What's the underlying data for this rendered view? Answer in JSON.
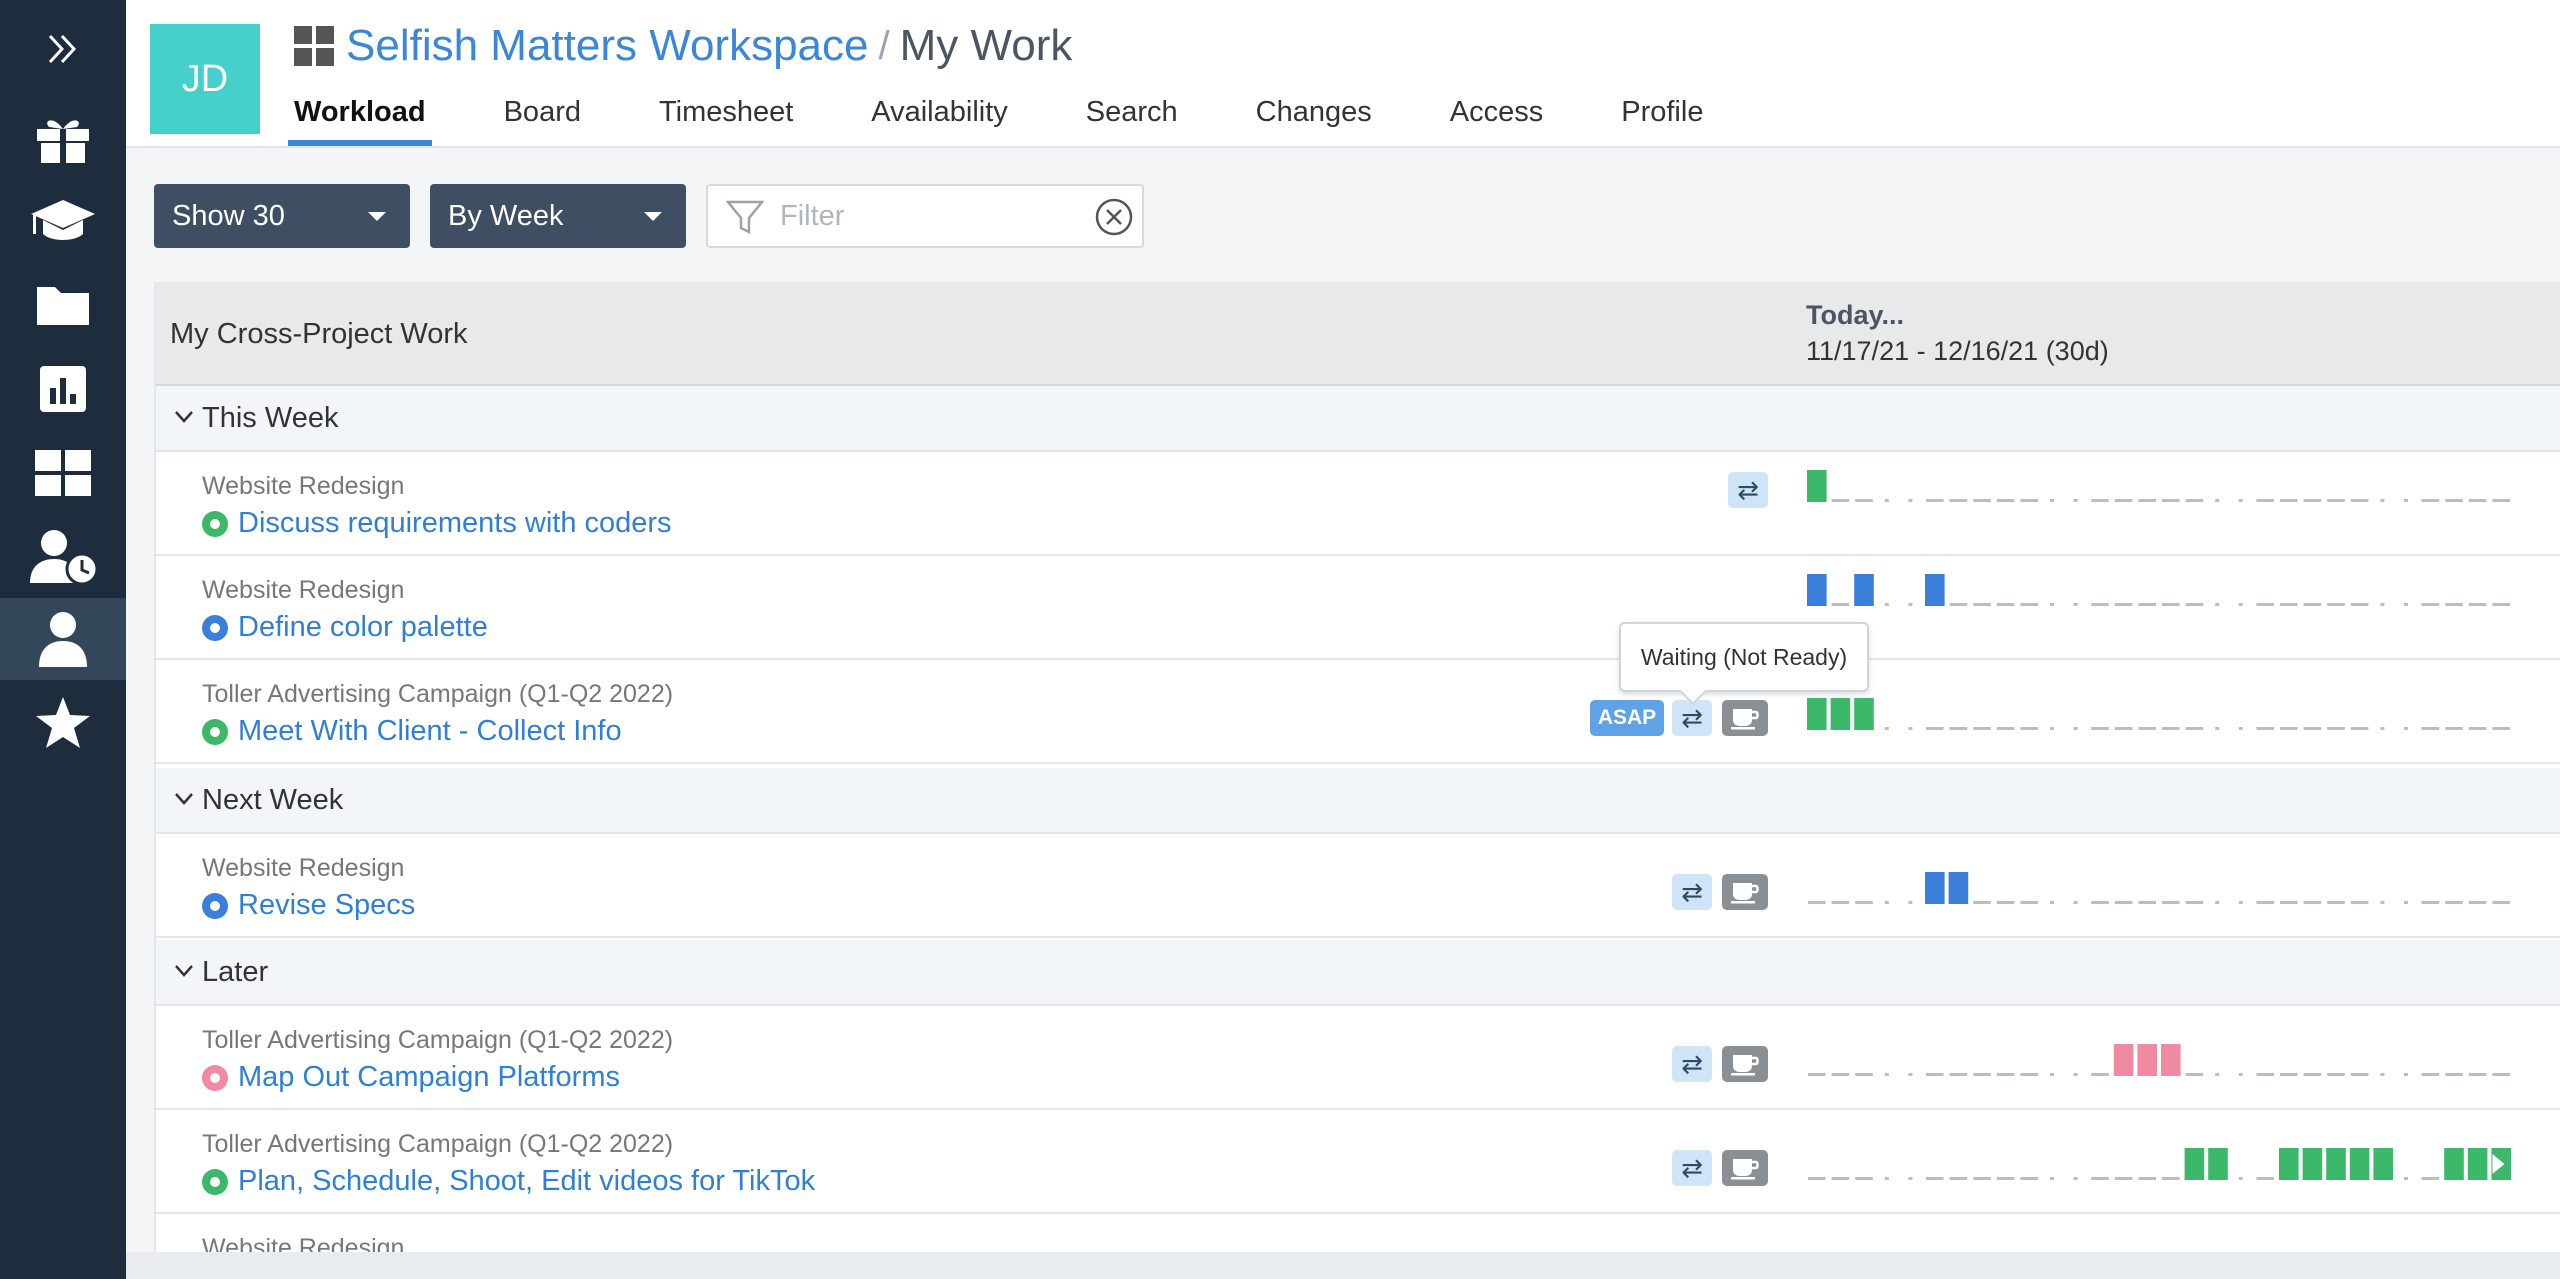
{
  "app": {
    "avatar_initials": "JD",
    "workspace": "Selfish Matters Workspace",
    "separator": "/",
    "page_title": "My Work",
    "accent_color": "#3a86d8",
    "avatar_color": "#45d0cb"
  },
  "sidebar": {
    "items": [
      {
        "icon": "expand-icon"
      },
      {
        "icon": "gift-icon"
      },
      {
        "icon": "graduation-cap-icon"
      },
      {
        "icon": "folder-icon"
      },
      {
        "icon": "chart-icon"
      },
      {
        "icon": "dashboard-grid-icon"
      },
      {
        "icon": "user-clock-icon"
      },
      {
        "icon": "user-icon",
        "active": true
      },
      {
        "icon": "star-icon"
      }
    ]
  },
  "tabs": [
    {
      "label": "Workload",
      "active": true
    },
    {
      "label": "Board"
    },
    {
      "label": "Timesheet"
    },
    {
      "label": "Availability"
    },
    {
      "label": "Search"
    },
    {
      "label": "Changes"
    },
    {
      "label": "Access"
    },
    {
      "label": "Profile"
    }
  ],
  "toolbar": {
    "show_label": "Show 30",
    "period_label": "By Week",
    "filter_placeholder": "Filter"
  },
  "table": {
    "title": "My Cross-Project Work",
    "today_label": "Today...",
    "range_label": "11/17/21 - 12/16/21 (30d)"
  },
  "badges": {
    "asap": "ASAP",
    "swap": "⇄"
  },
  "tooltip": "Waiting (Not Ready)",
  "groups": [
    {
      "label": "This Week"
    },
    {
      "label": "Next Week"
    },
    {
      "label": "Later"
    }
  ],
  "rows": [
    {
      "project": "Website Redesign",
      "task": "Discuss requirements with coders",
      "status": "green",
      "badges": [
        "swap"
      ],
      "timeline_color": "#3cb86a",
      "blocks": [
        0
      ]
    },
    {
      "project": "Website Redesign",
      "task": "Define color palette",
      "status": "blue",
      "badges": [],
      "timeline_color": "#3a7fd9",
      "blocks": [
        0,
        2,
        5
      ]
    },
    {
      "project": "Toller Advertising Campaign (Q1-Q2 2022)",
      "task": "Meet With Client - Collect Info",
      "status": "green",
      "badges": [
        "asap",
        "swap",
        "cup"
      ],
      "timeline_color": "#3cb86a",
      "blocks": [
        0,
        1,
        2
      ]
    },
    {
      "project": "Website Redesign",
      "task": "Revise Specs",
      "status": "blue",
      "badges": [
        "swap",
        "cup"
      ],
      "timeline_color": "#3a7fd9",
      "blocks": [
        5,
        6
      ]
    },
    {
      "project": "Toller Advertising Campaign (Q1-Q2 2022)",
      "task": "Map Out Campaign Platforms",
      "status": "pink",
      "badges": [
        "swap",
        "cup"
      ],
      "timeline_color": "#f08aa0",
      "blocks": [
        13,
        14,
        15
      ]
    },
    {
      "project": "Toller Advertising Campaign (Q1-Q2 2022)",
      "task": "Plan, Schedule, Shoot, Edit videos for TikTok",
      "status": "green",
      "badges": [
        "swap",
        "cup"
      ],
      "timeline_color": "#3cb86a",
      "blocks": [
        16,
        17,
        20,
        21,
        22,
        23,
        24,
        27,
        28,
        29
      ],
      "continues": true
    },
    {
      "project": "Website Redesign",
      "task": "",
      "status": "blue",
      "badges": [],
      "timeline_color": "#3a7fd9",
      "blocks": []
    }
  ]
}
